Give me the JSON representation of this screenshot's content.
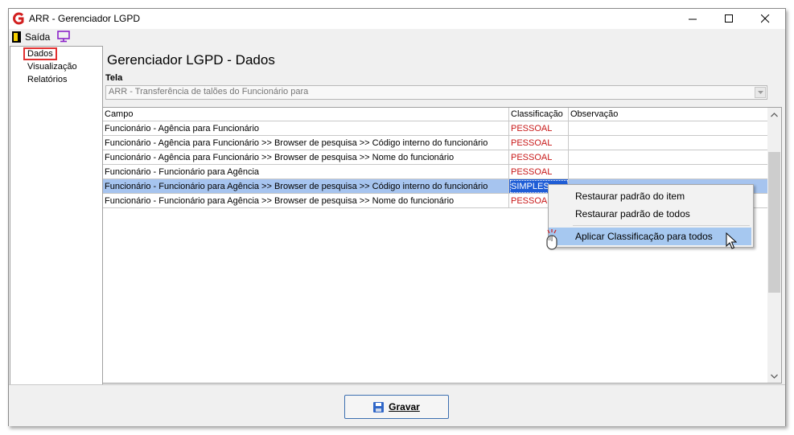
{
  "window": {
    "title": "ARR - Gerenciador LGPD",
    "controls": [
      "minimize",
      "maximize",
      "close"
    ]
  },
  "menu": {
    "exit_label": "Saída"
  },
  "sidebar": {
    "items": [
      {
        "label": "Dados",
        "selected": true
      },
      {
        "label": "Visualização",
        "selected": false
      },
      {
        "label": "Relatórios",
        "selected": false
      }
    ]
  },
  "main": {
    "title": "Gerenciador LGPD - Dados",
    "screen_label": "Tela",
    "screen_value": "ARR - Transferência de talões do Funcionário para"
  },
  "grid": {
    "columns": [
      "Campo",
      "Classificação",
      "Observação"
    ],
    "rows": [
      {
        "campo": "Funcionário - Agência para Funcionário",
        "classificacao": "PESSOAL",
        "observacao": ""
      },
      {
        "campo": "Funcionário - Agência para Funcionário >> Browser de pesquisa >> Código interno do funcionário",
        "classificacao": "PESSOAL",
        "observacao": ""
      },
      {
        "campo": "Funcionário - Agência para Funcionário >> Browser de pesquisa >> Nome do funcionário",
        "classificacao": "PESSOAL",
        "observacao": ""
      },
      {
        "campo": "Funcionário - Funcionário para Agência",
        "classificacao": "PESSOAL",
        "observacao": ""
      },
      {
        "campo": "Funcionário - Funcionário para Agência >> Browser de pesquisa >> Código interno do funcionário",
        "classificacao": "SIMPLES",
        "observacao": "",
        "selected": true
      },
      {
        "campo": "Funcionário - Funcionário para Agência >> Browser de pesquisa >> Nome do funcionário",
        "classificacao": "PESSOAL",
        "observacao": ""
      }
    ]
  },
  "context_menu": {
    "items": [
      {
        "label": "Restaurar padrão do item"
      },
      {
        "label": "Restaurar padrão de todos"
      },
      {
        "label": "Aplicar Classificação para todos",
        "highlighted": true
      }
    ]
  },
  "footer": {
    "save_label": "Gravar"
  },
  "colors": {
    "classification_text": "#c81818",
    "row_selected": "#a6c4ef",
    "cell_selected": "#1f5dd6",
    "menu_highlight": "#a6c8f0"
  }
}
